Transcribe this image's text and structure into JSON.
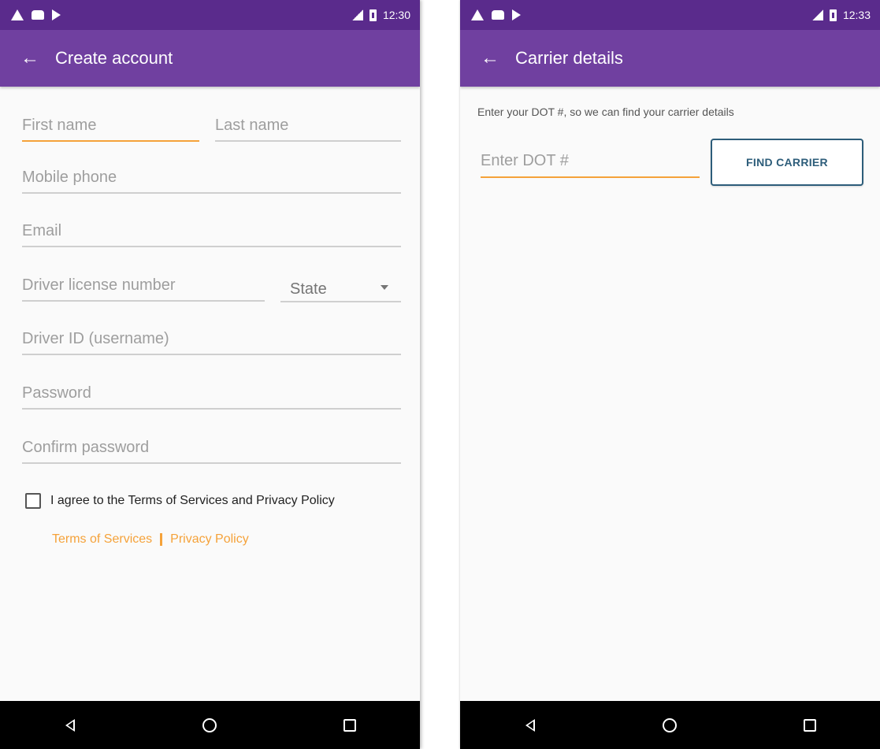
{
  "left_screen": {
    "status": {
      "time": "12:30",
      "icons": [
        "warning-icon",
        "car-icon",
        "play-store-icon",
        "signal-icon",
        "battery-icon"
      ]
    },
    "app_bar": {
      "title": "Create account"
    },
    "fields": {
      "first_name": "First name",
      "last_name": "Last name",
      "mobile_phone": "Mobile phone",
      "email": "Email",
      "driver_license": "Driver license number",
      "state": "State",
      "driver_id": "Driver ID (username)",
      "password": "Password",
      "confirm_password": "Confirm password"
    },
    "agree_text": "I agree to the Terms of Services and Privacy Policy",
    "links": {
      "terms": "Terms of Services",
      "privacy": "Privacy Policy"
    }
  },
  "right_screen": {
    "status": {
      "time": "12:33",
      "icons": [
        "warning-icon",
        "car-icon",
        "play-store-icon",
        "signal-icon",
        "battery-icon"
      ]
    },
    "app_bar": {
      "title": "Carrier details"
    },
    "hint": "Enter your DOT #, so we can find your carrier details",
    "dot_placeholder": "Enter DOT #",
    "find_button": "FIND CARRIER"
  },
  "colors": {
    "status_bar": "#5a2b8c",
    "app_bar": "#7040a0",
    "accent_orange": "#f5a23a",
    "button_border": "#2d5d7a"
  }
}
